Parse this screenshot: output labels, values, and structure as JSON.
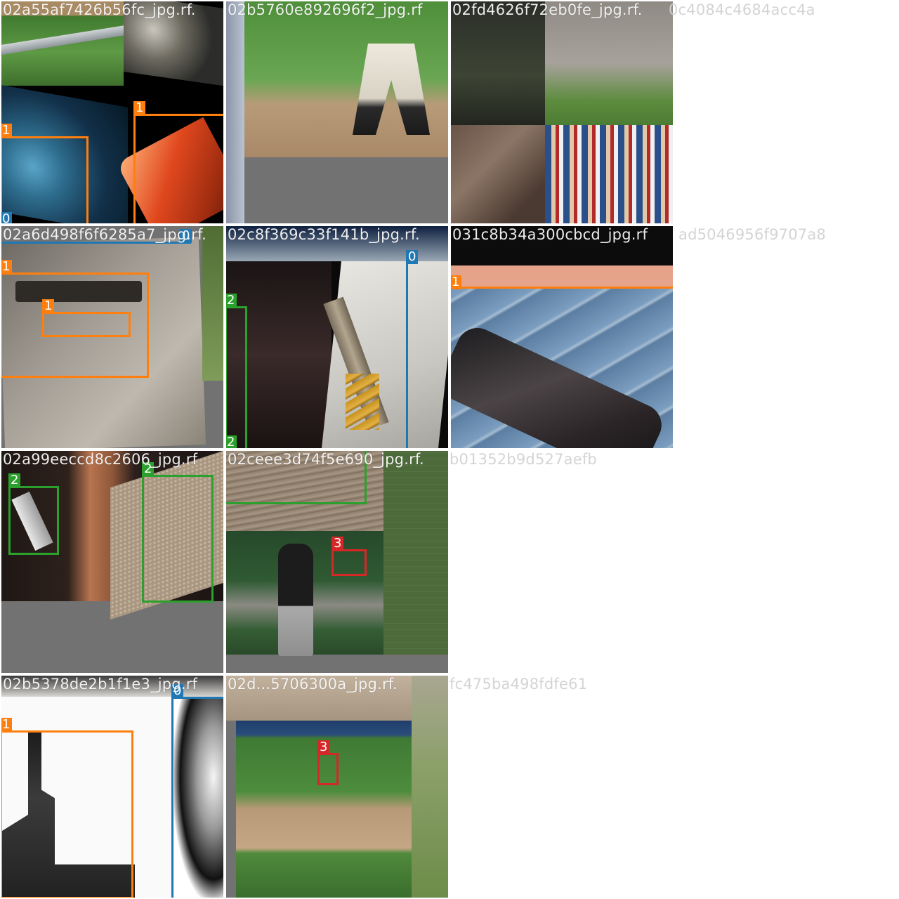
{
  "class_colors": {
    "0": "#1f77b4",
    "1": "#ff7f0e",
    "2": "#2ca02c",
    "3": "#d62728"
  },
  "tiles": [
    {
      "filename": "02a55af7426b56fc_jpg.rf.",
      "labels": [
        "1",
        "1",
        "0"
      ]
    },
    {
      "filename": "02b5760e892696f2_jpg.rf",
      "labels": []
    },
    {
      "filename": "02fd4626f72eb0fe_jpg.rf.",
      "filename_tail": "0c4084c4684acc4a",
      "labels": []
    },
    {
      "filename": "02a6d498f6f6285a7_jpg.rf.",
      "labels": [
        "1",
        "1",
        "0"
      ]
    },
    {
      "filename": "02c8f369c33f141b_jpg.rf.",
      "labels": [
        "0",
        "2",
        "2"
      ]
    },
    {
      "filename": "031c8b34a300cbcd_jpg.rf",
      "filename_tail": "ad5046956f9707a8",
      "labels": [
        "1"
      ]
    },
    {
      "filename": "02a99eeccd8c2606_jpg.rf",
      "labels": [
        "2",
        "2"
      ]
    },
    {
      "filename": "02ceee3d74f5e690_jpg.rf.",
      "filename_tail": "b01352b9d527aefb",
      "labels": [
        "3"
      ]
    },
    {
      "filename": "02b5378de2b1f1e3_jpg.rf",
      "labels": [
        "1",
        "0"
      ]
    },
    {
      "filename": "02d...5706300a_jpg.rf.",
      "filename_tail": "fc475ba498fdfe61",
      "labels": [
        "3"
      ]
    }
  ]
}
